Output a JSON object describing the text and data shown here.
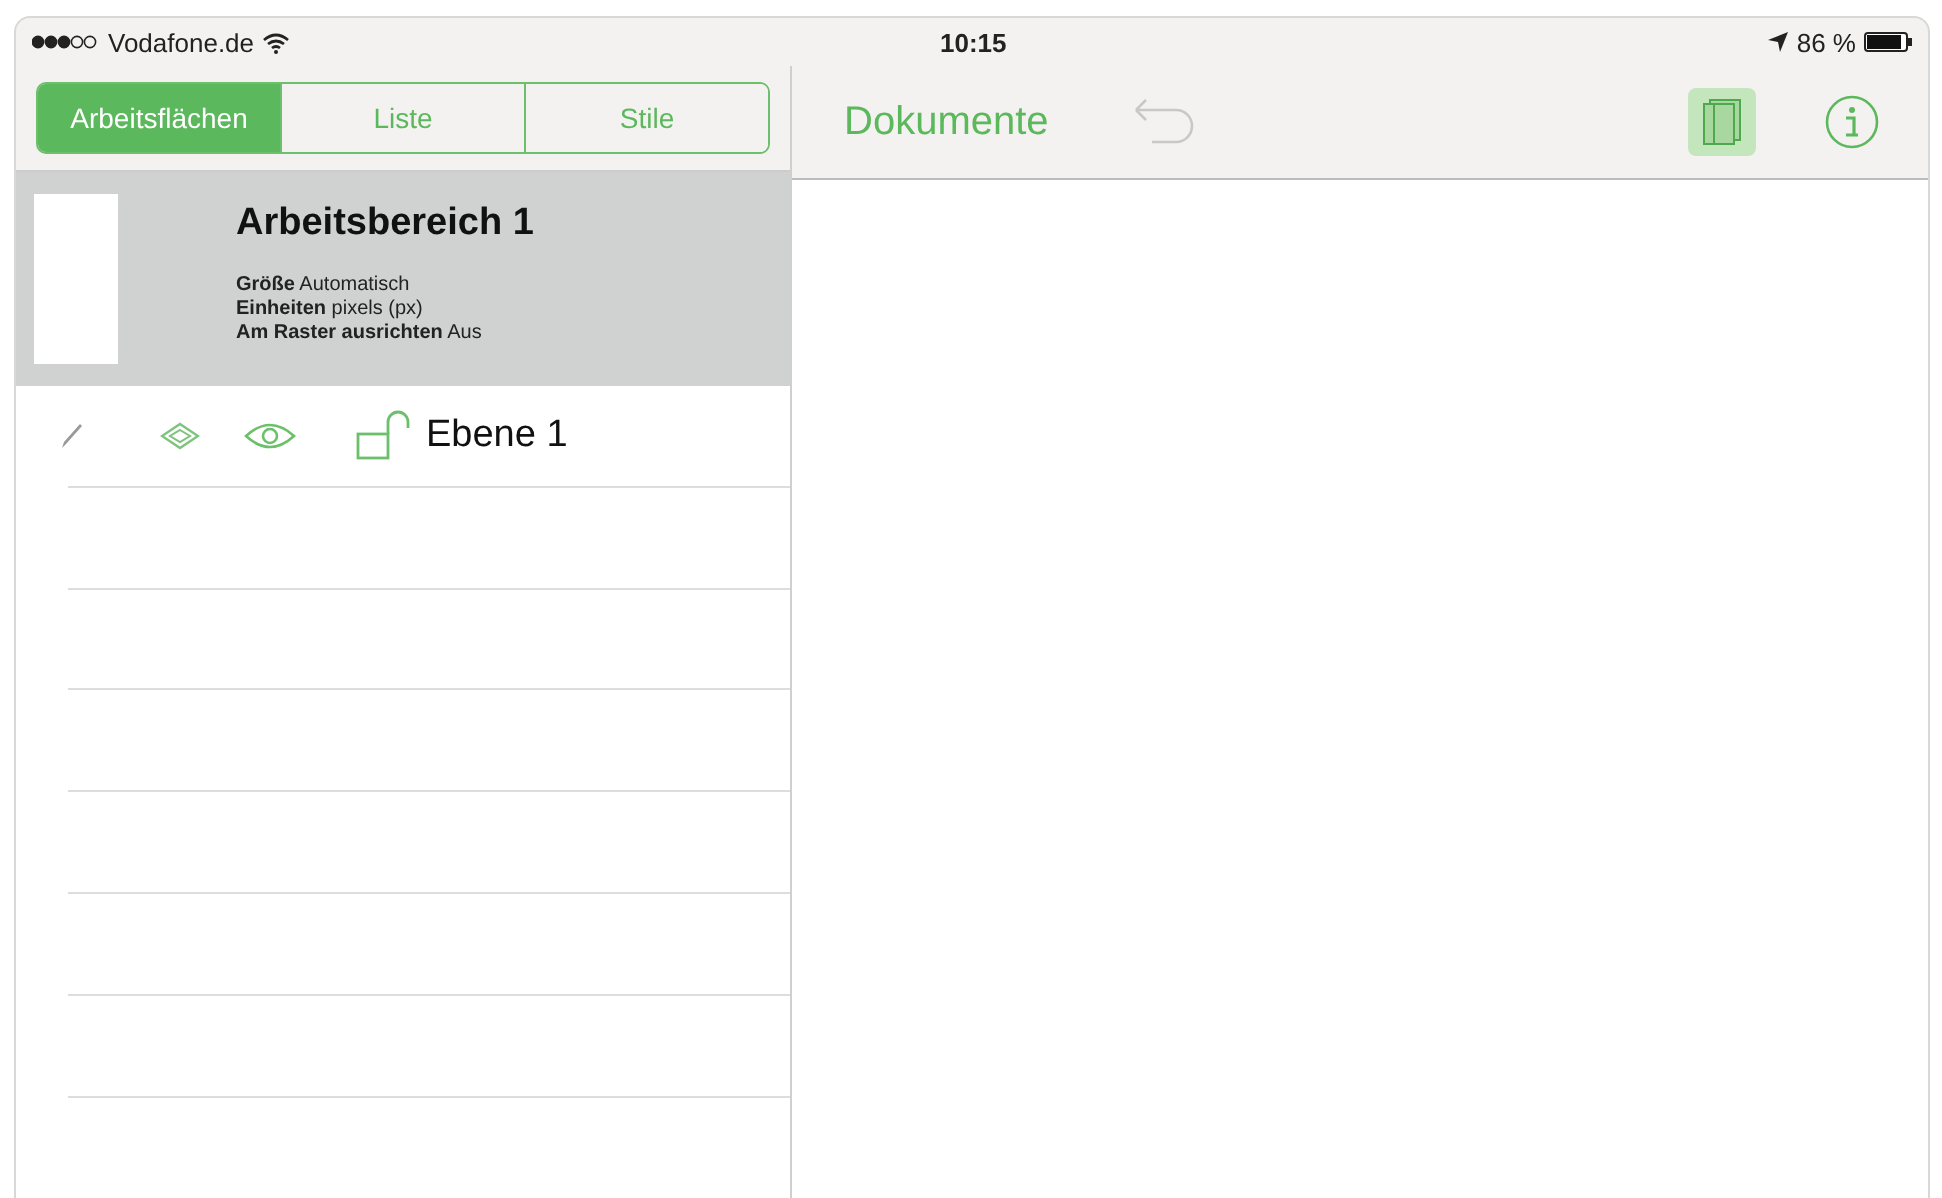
{
  "status_bar": {
    "carrier": "Vodafone.de",
    "time": "10:15",
    "battery": "86 %"
  },
  "tabs": [
    {
      "label": "Arbeitsflächen",
      "selected": true
    },
    {
      "label": "Liste",
      "selected": false
    },
    {
      "label": "Stile",
      "selected": false
    }
  ],
  "toolbar": {
    "back": "Dokumente",
    "undo": {
      "disabled": true
    },
    "panel_toggle": {
      "on": true
    }
  },
  "artboard": {
    "title": "Arbeitsbereich 1",
    "properties": [
      {
        "label": "Größe",
        "value": "Automatisch"
      },
      {
        "label": "Einheiten",
        "value": "pixels (px)"
      },
      {
        "label": "Am Raster ausrichten",
        "value": "Aus"
      }
    ]
  },
  "layers": [
    {
      "name": "Ebene 1",
      "locked": false
    }
  ]
}
